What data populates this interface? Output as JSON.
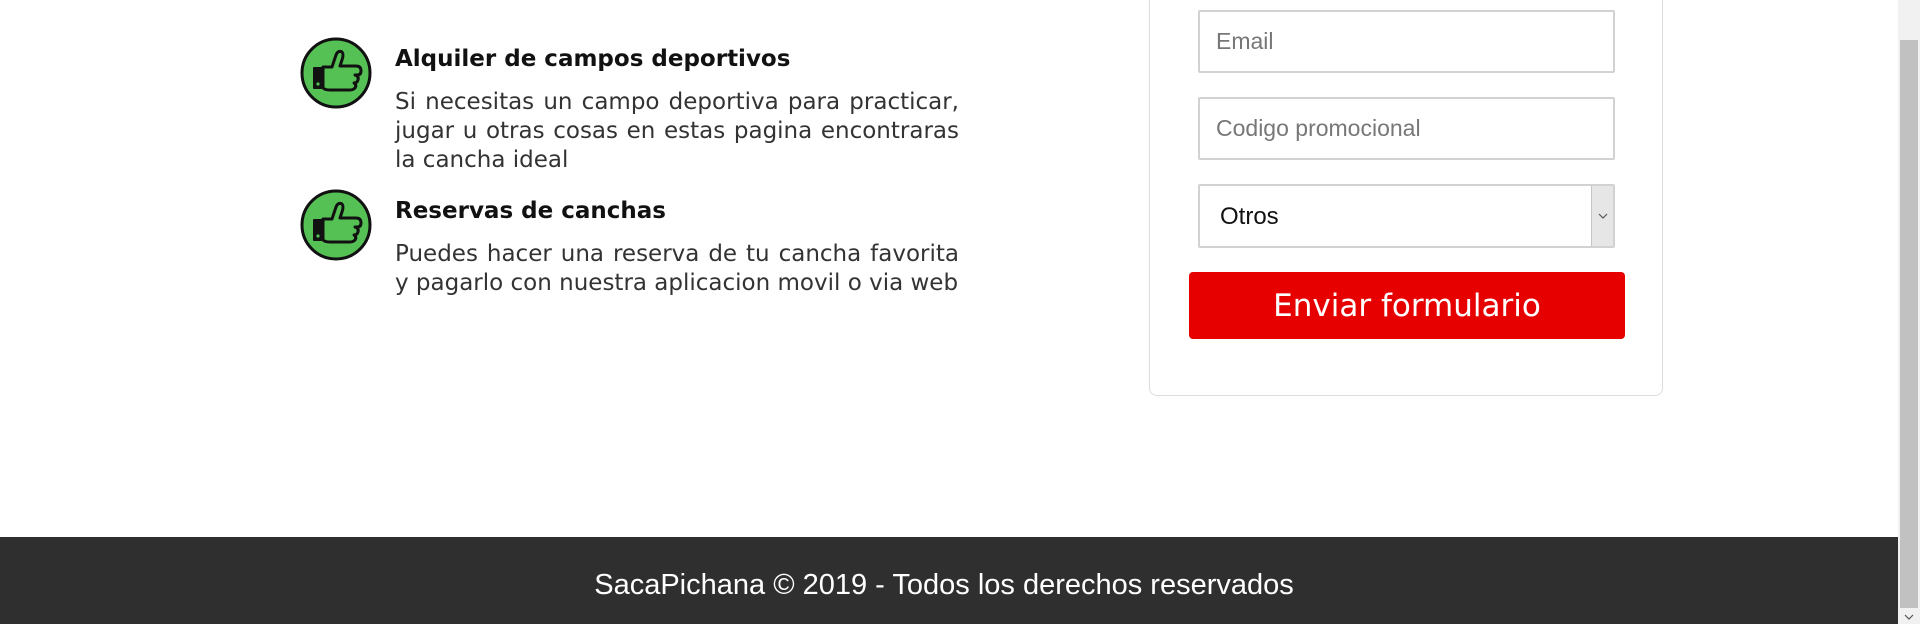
{
  "features": [
    {
      "title": "Alquiler de campos deportivos",
      "text": "Si necesitas un campo deportiva para practicar, jugar u otras cosas en estas pagina encontraras la cancha ideal",
      "icon": "thumbs-pointing-icon"
    },
    {
      "title": "Reservas de canchas",
      "text": "Puedes hacer una reserva de tu cancha favorita y pagarlo con nuestra aplicacion movil o via web",
      "icon": "thumbs-pointing-icon"
    }
  ],
  "form": {
    "email_placeholder": "Email",
    "promo_placeholder": "Codigo promocional",
    "select_value": "Otros",
    "submit_label": "Enviar formulario"
  },
  "footer": {
    "text": "SacaPichana © 2019 - Todos los derechos reservados"
  },
  "colors": {
    "accent_red": "#e60000",
    "icon_green": "#55c155",
    "footer_bg": "#2f2f2f"
  }
}
